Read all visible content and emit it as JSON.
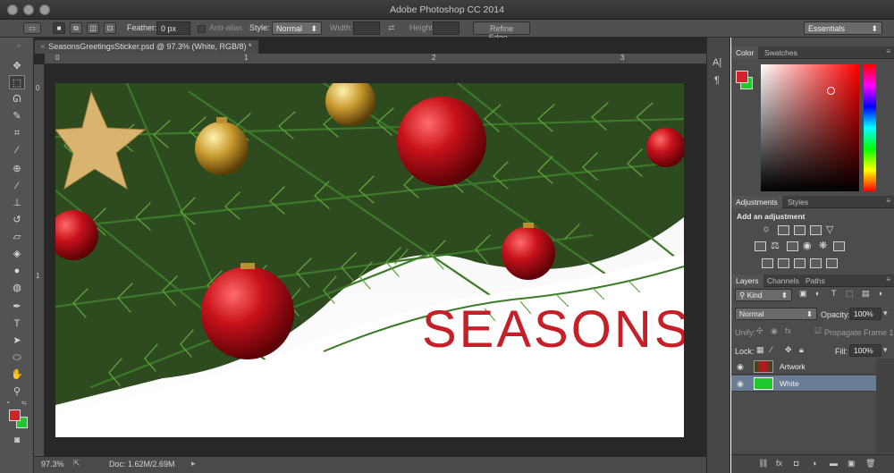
{
  "app": {
    "title": "Adobe Photoshop CC 2014"
  },
  "options_bar": {
    "feather_label": "Feather:",
    "feather_value": "0 px",
    "anti_alias_label": "Anti-alias",
    "style_label": "Style:",
    "style_value": "Normal",
    "width_label": "Width:",
    "height_label": "Height:",
    "refine_edge_label": "Refine Edge...",
    "workspace_value": "Essentials"
  },
  "document": {
    "tab_title": "SeasonsGreetingsSticker.psd @ 97.3% (White, RGB/8) *",
    "canvas_text": "SEASONS",
    "ruler_top": [
      "0",
      "1",
      "2",
      "3"
    ],
    "ruler_left": [
      "0",
      "1"
    ]
  },
  "status": {
    "zoom": "97.3%",
    "doc_size": "Doc: 1.62M/2.69M"
  },
  "color_panel": {
    "tabs": [
      "Color",
      "Swatches"
    ],
    "foreground": "#d0232a",
    "background": "#1fc92b"
  },
  "adjustments_panel": {
    "tabs": [
      "Adjustments",
      "Styles"
    ],
    "heading": "Add an adjustment"
  },
  "layers_panel": {
    "tabs": [
      "Layers",
      "Channels",
      "Paths"
    ],
    "filter_value": "Kind",
    "blend_mode": "Normal",
    "opacity_label": "Opacity:",
    "opacity_value": "100%",
    "unify_label": "Unify:",
    "propagate_label": "Propagate Frame 1",
    "lock_label": "Lock:",
    "fill_label": "Fill:",
    "fill_value": "100%",
    "layers": [
      {
        "name": "Artwork",
        "selected": false
      },
      {
        "name": "White",
        "selected": true
      }
    ]
  }
}
